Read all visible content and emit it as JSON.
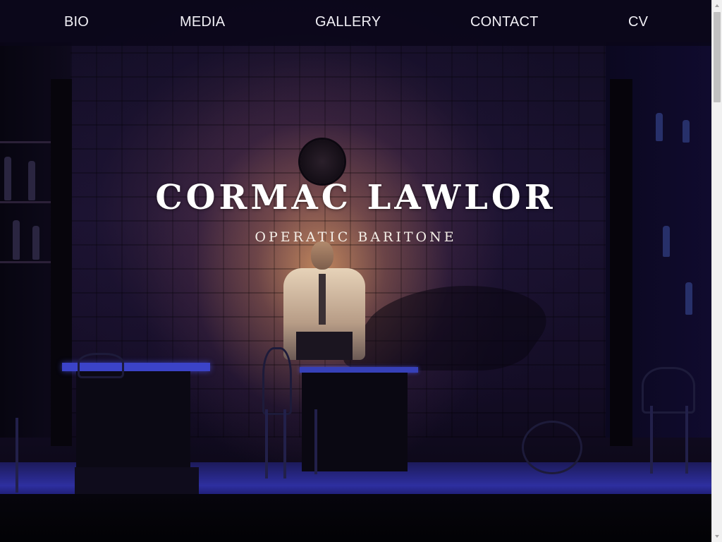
{
  "nav": {
    "items": [
      {
        "label": "BIO"
      },
      {
        "label": "MEDIA"
      },
      {
        "label": "GALLERY"
      },
      {
        "label": "CONTACT"
      },
      {
        "label": "CV"
      }
    ]
  },
  "hero": {
    "title": "CORMAC LAWLOR",
    "subtitle": "OPERATIC BARITONE",
    "background_image": "stage-scene-photo"
  },
  "colors": {
    "nav_background": "#0a0618",
    "text": "#ffffff",
    "stage_light": "#2e2fa0",
    "spotlight": "#d6965e"
  },
  "scrollbar": {
    "scroll_position": 0
  }
}
